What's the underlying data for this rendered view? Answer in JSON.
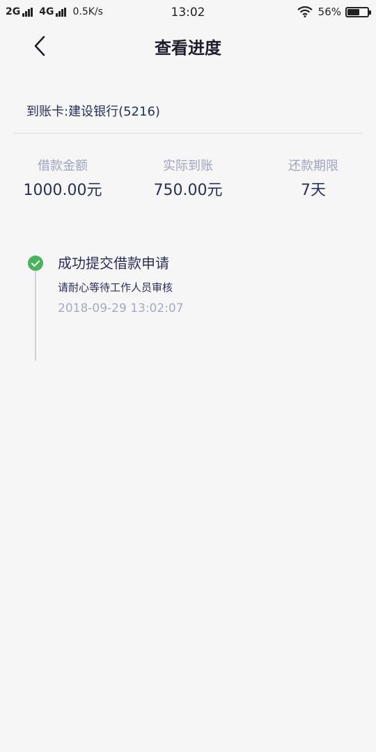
{
  "status_bar": {
    "network1": "2G",
    "network2": "4G",
    "speed": "0.5K/s",
    "time": "13:02",
    "battery_percent": "56%",
    "battery_level": 0.56,
    "icons": [
      "signal-icon",
      "wifi-icon",
      "battery-icon"
    ]
  },
  "header": {
    "title": "查看进度",
    "back_icon": "chevron-left-icon"
  },
  "card": {
    "label": "到账卡:建设银行(5216)"
  },
  "stats": [
    {
      "label": "借款金额",
      "value": "1000.00元"
    },
    {
      "label": "实际到账",
      "value": "750.00元"
    },
    {
      "label": "还款期限",
      "value": "7天"
    }
  ],
  "timeline": [
    {
      "title": "成功提交借款申请",
      "subtitle": "请耐心等待工作人员审核",
      "time": "2018-09-29 13:02:07",
      "status_icon": "check-circle-icon",
      "status_color": "#4bb35b"
    }
  ],
  "colors": {
    "background": "#f6f6f7",
    "primary_text": "#2a2f55",
    "secondary_text": "#9ea3be",
    "success": "#4bb35b"
  }
}
